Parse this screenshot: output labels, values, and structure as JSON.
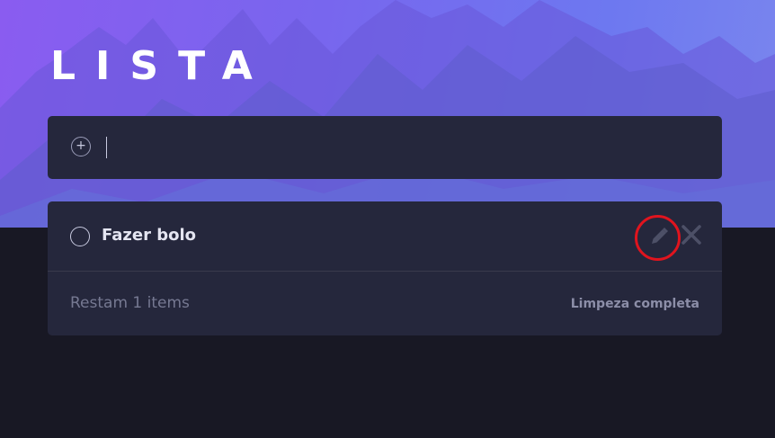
{
  "header": {
    "title": "LISTA"
  },
  "new_todo": {
    "placeholder": "",
    "value": "",
    "add_icon": "plus-circle-icon"
  },
  "todos": {
    "items": [
      {
        "label": "Fazer bolo",
        "completed": false,
        "edit_icon": "pencil-icon",
        "delete_icon": "close-icon"
      }
    ]
  },
  "footer": {
    "items_left": "Restam 1 items",
    "clear_label": "Limpeza completa"
  },
  "colors": {
    "background": "#181824",
    "card": "#25273c",
    "text": "#e4e5f1",
    "muted": "#767992",
    "highlight": "#e0141e"
  }
}
